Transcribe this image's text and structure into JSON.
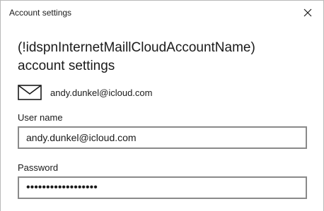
{
  "window": {
    "title": "Account settings"
  },
  "heading": {
    "line1": "(!idspnInternetMaillCloudAccountName)",
    "line2": "account settings"
  },
  "account": {
    "icon": "mail-icon",
    "email": "andy.dunkel@icloud.com"
  },
  "fields": {
    "username_label": "User name",
    "username_value": "andy.dunkel@icloud.com",
    "password_label": "Password",
    "password_value": "••••••••••••••••••"
  }
}
